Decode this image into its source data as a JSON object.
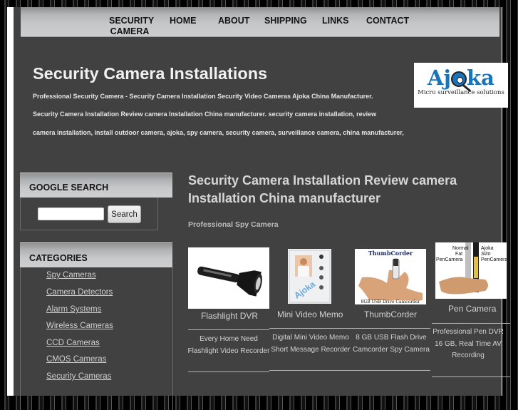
{
  "nav": {
    "items": [
      {
        "label": "SECURITY CAMERA"
      },
      {
        "label": "HOME"
      },
      {
        "label": "ABOUT"
      },
      {
        "label": "SHIPPING"
      },
      {
        "label": "LINKS"
      },
      {
        "label": "CONTACT"
      }
    ]
  },
  "header": {
    "title": "Security Camera Installations",
    "tagline_lines": [
      "Professional Security Camera - Security Camera Installation Security Video Cameras Ajoka China Manufacturer.",
      "Security Camera Installation Review camera Installation China manufacturer. security camera installation, review",
      "camera installation, install outdoor camera, ajoka, spy camera, security camera, surveillance camera, china manufacturer,"
    ],
    "logo": {
      "word_left": "Aj",
      "word_right": "ka",
      "subtitle": "Micro surveillance solutions",
      "brand_color": "#1b73b8"
    }
  },
  "sidebar": {
    "search_widget": {
      "title": "GOOGLE SEARCH",
      "input_value": "",
      "button_label": "Search"
    },
    "categories_widget": {
      "title": "CATEGORIES",
      "items": [
        {
          "label": "Spy Cameras"
        },
        {
          "label": "Camera Detectors"
        },
        {
          "label": "Alarm Systems"
        },
        {
          "label": "Wireless Cameras"
        },
        {
          "label": "CCD Cameras"
        },
        {
          "label": "CMOS Cameras"
        },
        {
          "label": "Security Cameras"
        }
      ]
    }
  },
  "main": {
    "title": "Security Camera Installation Review camera Installation China manufacturer",
    "subtitle": "Professional Spy Camera",
    "products": [
      {
        "name": "Flashlight DVR",
        "desc_lines": [
          "Every Home Need",
          "Flashlight Video Recorder"
        ]
      },
      {
        "name": "Mini Video Memo",
        "desc_lines": [
          "Digital Mini Video Memo",
          "Short Message Recorder"
        ]
      },
      {
        "name": "ThumbCorder",
        "image_caption_top": "ThumbCorder",
        "image_caption_bottom": "8GB USB Drive Camcorder",
        "desc_lines": [
          "8 GB USB Flash Drive",
          "Camcorder Spy Camera"
        ]
      },
      {
        "name": "Pen Camera",
        "image_label_left": [
          "Normal",
          "Fat",
          "PenCamera"
        ],
        "image_label_right": [
          "Ajoka",
          "Slim",
          "PenCamera"
        ],
        "desc_lines": [
          "Professional Pen DVR",
          "16 GB, Real Time AV",
          "Recording"
        ]
      }
    ]
  }
}
